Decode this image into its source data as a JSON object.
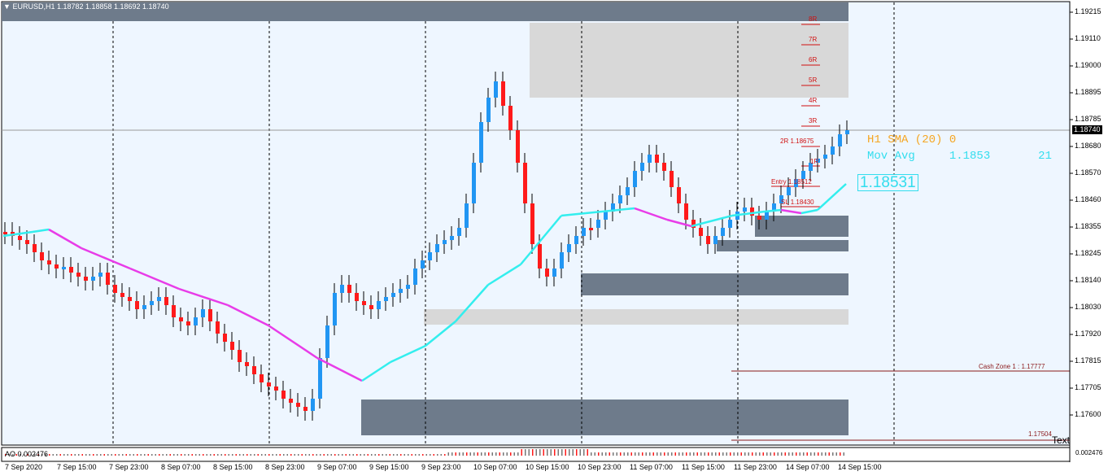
{
  "header": {
    "symbol_line": "EURUSD,H1  1.18782 1.18858 1.18692 1.18740",
    "menu_arrow": "dropdown-triangle"
  },
  "price_axis": {
    "labels": [
      "1.19215",
      "1.19110",
      "1.19000",
      "1.18895",
      "1.18785",
      "1.18680",
      "1.18570",
      "1.18460",
      "1.18355",
      "1.18245",
      "1.18140",
      "1.18030",
      "1.17920",
      "1.17815",
      "1.17705",
      "1.17600"
    ],
    "current_price": "1.18740",
    "bottom_label": "1.17504"
  },
  "time_axis": {
    "labels": [
      "7 Sep 2020",
      "7 Sep 15:00",
      "7 Sep 23:00",
      "8 Sep 07:00",
      "8 Sep 15:00",
      "8 Sep 23:00",
      "9 Sep 07:00",
      "9 Sep 15:00",
      "9 Sep 23:00",
      "10 Sep 07:00",
      "10 Sep 15:00",
      "10 Sep 23:00",
      "11 Sep 07:00",
      "11 Sep 15:00",
      "11 Sep 23:00",
      "14 Sep 07:00",
      "14 Sep 15:00"
    ]
  },
  "indicators": {
    "sma_line": "H1 SMA (20) 0",
    "mov_avg_label": "Mov Avg",
    "mov_avg_value": "1.1853",
    "mov_avg_count": "21",
    "ma_box_value": "1.18531"
  },
  "levels": {
    "r_labels": [
      "8R",
      "7R",
      "6R",
      "5R",
      "4R",
      "3R"
    ],
    "two_r": "2R 1.18675",
    "one_r": "1R",
    "entry": "Entry 1.18512",
    "sl": "SL 1.18430",
    "cash_zone": "Cash Zone 1 : 1.17777",
    "lower_level": "1.17504",
    "text_obj": "Text"
  },
  "oscillator": {
    "label": "AO 0.002476",
    "right_label": "0.002476"
  },
  "colors": {
    "bull": "#2196f3",
    "bear": "#ff1a1a",
    "ma_down": "#e83ce8",
    "ma_up": "#33eeee",
    "zone_dark": "#6e7b8b",
    "zone_light": "#d8d8d8",
    "bg": "#eef6ff"
  }
}
